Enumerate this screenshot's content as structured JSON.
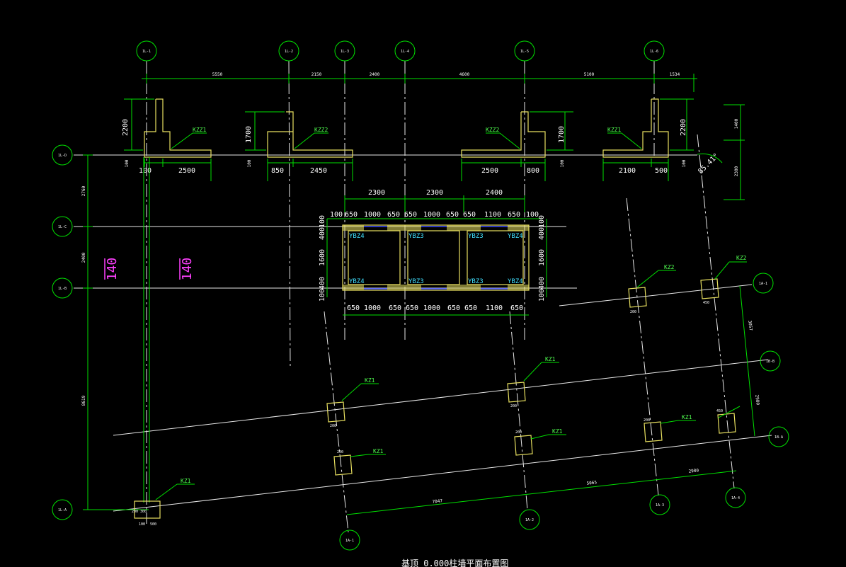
{
  "axes_top": [
    "1L-1",
    "1L-2",
    "1L-3",
    "1L-4",
    "1L-5",
    "1L-6"
  ],
  "axes_left": [
    "1L-D",
    "1L-C",
    "1L-B",
    "1L-A"
  ],
  "axes_right": [
    "1A-1",
    "1B-B",
    "1B-A"
  ],
  "axes_bottom": [
    "1A-1",
    "1A-2",
    "1A-3",
    "1A-4"
  ],
  "top_dims": [
    "5550",
    "2150",
    "2400",
    "4600",
    "5100",
    "1534"
  ],
  "left_dims": [
    "2760",
    "2400",
    "8619"
  ],
  "right_dims": [
    "1400",
    "2300"
  ],
  "angle_label": "85.41°",
  "rotated_dims": [
    "3057",
    "2980",
    "7047",
    "5065",
    "2980"
  ],
  "footings": [
    {
      "label": "KZZ1",
      "h": "2200",
      "t": "100",
      "w1": "100",
      "w2": "2500"
    },
    {
      "label": "KZZ2",
      "h": "1700",
      "t": "100",
      "w1": "850",
      "w2": "2450"
    },
    {
      "label": "KZZ2",
      "h": "1700",
      "t": "100",
      "w1": "2500",
      "w2": "800"
    },
    {
      "label": "KZZ1",
      "h": "2200",
      "t": "100",
      "w1": "2100",
      "w2": "500"
    }
  ],
  "core": {
    "span_dims": [
      "2300",
      "2300",
      "2400"
    ],
    "top_row": [
      "100",
      "650",
      "1000",
      "650",
      "650",
      "1000",
      "650",
      "650",
      "1100",
      "650",
      "100"
    ],
    "bottom_row": [
      "650",
      "1000",
      "650",
      "650",
      "1000",
      "650",
      "650",
      "1100",
      "650"
    ],
    "side_dims": [
      "100",
      "400",
      "1600",
      "400",
      "100"
    ],
    "walls": [
      "YBZ4",
      "YBZ3",
      "YBZ3",
      "YBZ4",
      "YBZ4",
      "YBZ3",
      "YBZ3",
      "YBZ4"
    ]
  },
  "thickness_labels": [
    "140",
    "140"
  ],
  "column_labels": [
    "KZ2",
    "KZ2",
    "KZ1",
    "KZ1",
    "KZ1",
    "KZ1",
    "KZ1",
    "KZ1",
    "KZ1"
  ],
  "column_dims_a": "200",
  "column_dims_b": "250",
  "column_dims_c": "450",
  "left_col_dims": [
    "200 300",
    "100",
    "500"
  ],
  "title": "基顶 0.000柱墙平面布置图",
  "colors": {
    "background": "#000000",
    "axis": "#00e000",
    "outline": "#e8e8e8",
    "member": "#e8e060",
    "wall_label": "#40e0ff",
    "thickness": "#ff40ff",
    "beam": "#3a4cff"
  }
}
